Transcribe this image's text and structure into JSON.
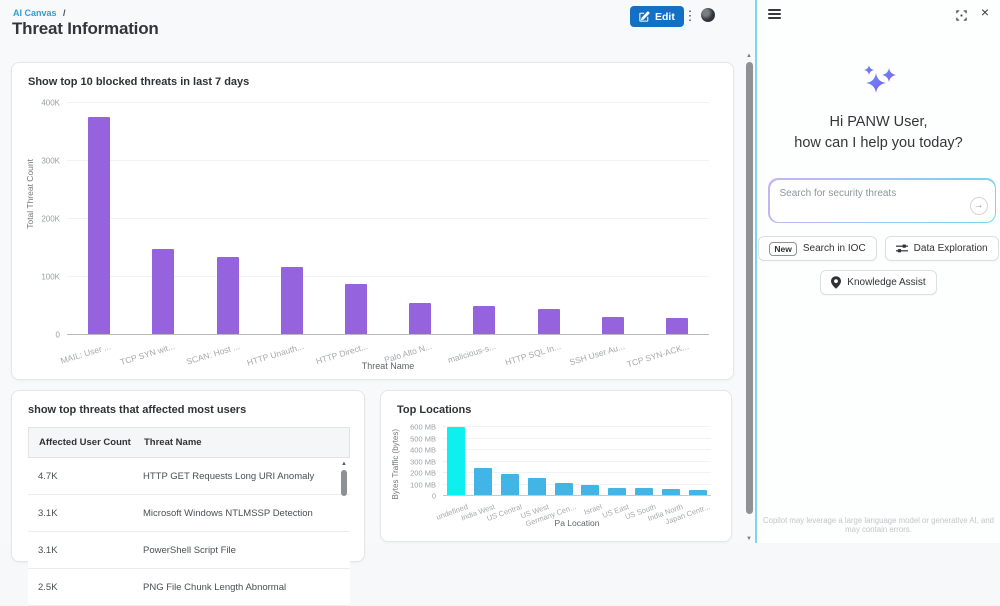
{
  "header": {
    "breadcrumb": "AI Canvas",
    "breadcrumb_sep": "/",
    "title": "Threat Information",
    "edit_label": "Edit"
  },
  "icons": {
    "kebab": "⋮",
    "close": "×",
    "send_arrow": "→",
    "scroll_up": "▲",
    "scroll_down": "▼"
  },
  "threat_table": {
    "title": "show top threats that affected most users",
    "columns": [
      "Affected User Count",
      "Threat Name"
    ],
    "rows": [
      [
        "4.7K",
        "HTTP GET Requests Long URI Anomaly"
      ],
      [
        "3.1K",
        "Microsoft Windows NTLMSSP Detection"
      ],
      [
        "3.1K",
        "PowerShell Script File"
      ],
      [
        "2.5K",
        "PNG File Chunk Length Abnormal"
      ]
    ]
  },
  "chart_data": [
    {
      "type": "bar",
      "title": "Show top 10 blocked threats in last 7 days",
      "categories": [
        "MAIL: User ...",
        "TCP SYN wit...",
        "SCAN: Host ...",
        "HTTP Unauth...",
        "HTTP Direct...",
        "Palo Alto N...",
        "malicious-s...",
        "HTTP SQL In...",
        "SSH User Au...",
        "TCP SYN-ACK..."
      ],
      "values": [
        375000,
        148000,
        134000,
        116000,
        86000,
        53000,
        48000,
        43000,
        29000,
        28000
      ],
      "xlabel": "Threat Name",
      "ylabel": "Total Threat Count",
      "ylim": [
        0,
        400000
      ],
      "yticks": [
        0,
        100000,
        200000,
        300000,
        400000
      ],
      "ytick_labels": [
        "0",
        "100K",
        "200K",
        "300K",
        "400K"
      ],
      "bar_color": "#9663de",
      "grid": true,
      "legend": "none"
    },
    {
      "type": "bar",
      "title": "Top Locations",
      "categories": [
        "undefined",
        "India West",
        "US Central",
        "US West",
        "Germany Cen...",
        "Israel",
        "US East",
        "US South",
        "India North",
        "Japan Centr..."
      ],
      "values": [
        600,
        235,
        190,
        155,
        105,
        85,
        65,
        62,
        50,
        40
      ],
      "unit": "MB",
      "xlabel": "Pa Location",
      "ylabel": "Bytes Traffic (bytes)",
      "ylim": [
        0,
        620
      ],
      "yticks": [
        0,
        100,
        200,
        300,
        400,
        500,
        600
      ],
      "ytick_labels": [
        "0",
        "100 MB",
        "200 MB",
        "300 MB",
        "400 MB",
        "500 MB",
        "600 MB"
      ],
      "bar_color": "#41b6e6",
      "highlight_index": 0,
      "highlight_color": "#0ef0f0",
      "grid": true,
      "legend": "none"
    }
  ],
  "copilot": {
    "greeting_line1": "Hi PANW User,",
    "greeting_line2": "how can I help you today?",
    "search_placeholder": "Search for security threats",
    "actions": [
      {
        "badge": "New",
        "label": "Search in IOC"
      },
      {
        "label": "Data Exploration"
      },
      {
        "label": "Knowledge Assist"
      }
    ],
    "disclaimer": "Copilot may leverage a large language model or generative AI, and may contain errors."
  },
  "colors": {
    "accent_blue": "#1271c4",
    "breadcrumb_blue": "#2b9fdc",
    "panel_border_cyan": "#7fd6e6",
    "threat_bar_purple": "#9663de",
    "location_bar_blue": "#41b6e6",
    "location_bar_cyan": "#0ef0f0"
  }
}
